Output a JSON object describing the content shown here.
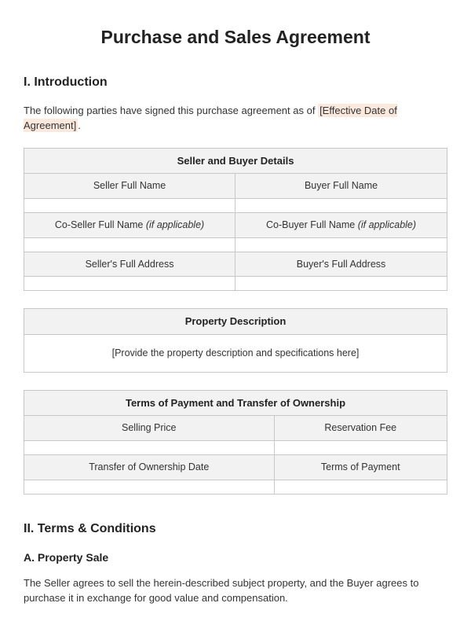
{
  "title": "Purchase and Sales Agreement",
  "section1": {
    "heading": "I. Introduction",
    "intro_before": "The following parties have signed this purchase agreement as of ",
    "intro_placeholder": "[Effective Date of Agreement]",
    "intro_after": "."
  },
  "table1": {
    "title": "Seller and Buyer Details",
    "rows": [
      {
        "left": "Seller Full Name",
        "right": "Buyer Full Name"
      },
      {
        "left_label": "Co-Seller Full Name ",
        "left_italic": "(if applicable)",
        "right_label": "Co-Buyer Full Name ",
        "right_italic": "(if applicable)"
      },
      {
        "left": "Seller's Full Address",
        "right": "Buyer's Full Address"
      }
    ]
  },
  "table2": {
    "title": "Property Description",
    "desc": "[Provide the property description and specifications here]"
  },
  "table3": {
    "title": "Terms of Payment and Transfer of Ownership",
    "rows": [
      {
        "left": "Selling Price",
        "right": "Reservation Fee"
      },
      {
        "left": "Transfer of Ownership Date",
        "right": "Terms of Payment"
      }
    ]
  },
  "section2": {
    "heading": "II. Terms & Conditions",
    "sub_heading": "A. Property Sale",
    "para": "The Seller agrees to sell the herein-described subject property, and the Buyer agrees to purchase it in exchange for good value and compensation."
  }
}
